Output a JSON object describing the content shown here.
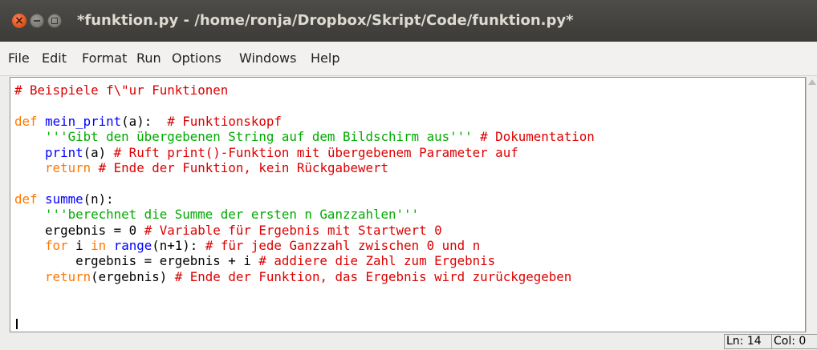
{
  "window": {
    "title": "*funktion.py - /home/ronja/Dropbox/Skript/Code/funktion.py*"
  },
  "menu": [
    {
      "label": "File"
    },
    {
      "label": "Edit"
    },
    {
      "label": "Format"
    },
    {
      "label": "Run"
    },
    {
      "label": "Options"
    },
    {
      "label": "Windows"
    },
    {
      "label": "Help"
    }
  ],
  "code_lines": [
    [
      {
        "t": "# Beispiele f\\\"ur Funktionen",
        "c": "cm"
      }
    ],
    [],
    [
      {
        "t": "def",
        "c": "kw"
      },
      {
        "t": " "
      },
      {
        "t": "mein_print",
        "c": "df"
      },
      {
        "t": "(a):  "
      },
      {
        "t": "# Funktionskopf",
        "c": "cm"
      }
    ],
    [
      {
        "t": "    "
      },
      {
        "t": "'''Gibt den übergebenen String auf dem Bildschirm aus'''",
        "c": "st"
      },
      {
        "t": " "
      },
      {
        "t": "# Dokumentation",
        "c": "cm"
      }
    ],
    [
      {
        "t": "    "
      },
      {
        "t": "print",
        "c": "df"
      },
      {
        "t": "(a) "
      },
      {
        "t": "# Ruft print()-Funktion mit übergebenem Parameter auf",
        "c": "cm"
      }
    ],
    [
      {
        "t": "    "
      },
      {
        "t": "return",
        "c": "kw"
      },
      {
        "t": " "
      },
      {
        "t": "# Ende der Funktion, kein Rückgabewert",
        "c": "cm"
      }
    ],
    [],
    [
      {
        "t": "def",
        "c": "kw"
      },
      {
        "t": " "
      },
      {
        "t": "summe",
        "c": "df"
      },
      {
        "t": "(n):"
      }
    ],
    [
      {
        "t": "    "
      },
      {
        "t": "'''berechnet die Summe der ersten n Ganzzahlen'''",
        "c": "st"
      }
    ],
    [
      {
        "t": "    ergebnis = 0 "
      },
      {
        "t": "# Variable für Ergebnis mit Startwert 0",
        "c": "cm"
      }
    ],
    [
      {
        "t": "    "
      },
      {
        "t": "for",
        "c": "kw"
      },
      {
        "t": " i "
      },
      {
        "t": "in",
        "c": "kw"
      },
      {
        "t": " "
      },
      {
        "t": "range",
        "c": "df"
      },
      {
        "t": "(n+1): "
      },
      {
        "t": "# für jede Ganzzahl zwischen 0 und n",
        "c": "cm"
      }
    ],
    [
      {
        "t": "        ergebnis = ergebnis + i "
      },
      {
        "t": "# addiere die Zahl zum Ergebnis",
        "c": "cm"
      }
    ],
    [
      {
        "t": "    "
      },
      {
        "t": "return",
        "c": "kw"
      },
      {
        "t": "(ergebnis) "
      },
      {
        "t": "# Ende der Funktion, das Ergebnis wird zurückgegeben",
        "c": "cm"
      }
    ]
  ],
  "status": {
    "line": "Ln: 14",
    "col": "Col: 0"
  }
}
